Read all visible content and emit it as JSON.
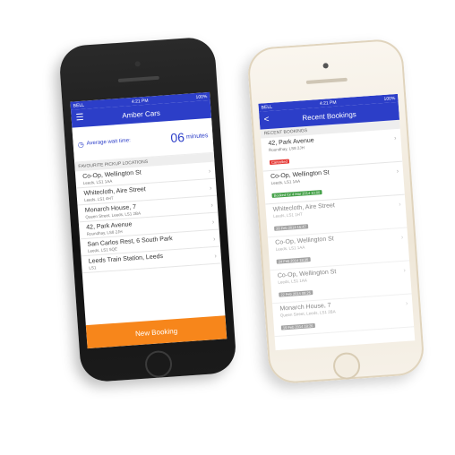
{
  "left": {
    "status": {
      "carrier": "BELL",
      "time": "4:21 PM",
      "battery": "100%"
    },
    "nav": {
      "title": "Amber Cars"
    },
    "wait": {
      "label": "Average wait time:",
      "value": "06",
      "unit": "minutes"
    },
    "section": "FAVOURITE PICKUP LOCATIONS",
    "locations": [
      {
        "title": "Co-Op, Wellington St",
        "sub": "Leeds, LS1 1AA"
      },
      {
        "title": "Whitecloth, Aire Street",
        "sub": "Leeds, LS1 4HT"
      },
      {
        "title": "Monarch House, 7",
        "sub": "Queen Street, Leeds, LS1 2BA"
      },
      {
        "title": "42, Park Avenue",
        "sub": "Roundhay, LS8 2JH"
      },
      {
        "title": "San Carlos Rest, 6 South Park",
        "sub": "Leeds, LS1 5QE"
      },
      {
        "title": "Leeds Train Station, Leeds",
        "sub": "LS1"
      }
    ],
    "cta": "New Booking"
  },
  "right": {
    "status": {
      "carrier": "BELL",
      "time": "4:21 PM",
      "battery": "100%"
    },
    "nav": {
      "title": "Recent Bookings",
      "back": "<"
    },
    "section": "RECENT BOOKINGS",
    "bookings": [
      {
        "title": "42, Park Avenue",
        "sub": "Roundhay, LS8 2JH",
        "badge": "Cancelled",
        "color": "#e53935"
      },
      {
        "title": "Co-Op, Wellington St",
        "sub": "Leeds, LS1 1AA",
        "badge": "Booked for 4 Mar 2014 10:00",
        "color": "#43a047"
      },
      {
        "title": "Whitecloth, Aire Street",
        "sub": "Leeds, LS1 1HT",
        "badge": "28 Feb 2014 15:47",
        "color": "#666666",
        "faded": true
      },
      {
        "title": "Co-Op, Wellington St",
        "sub": "Leeds, LS1 1AA",
        "badge": "24 Feb 2014 18:35",
        "color": "#666666",
        "faded": true
      },
      {
        "title": "Co-Op, Wellington St",
        "sub": "Leeds, LS1 1AA",
        "badge": "22 Feb 2014 09:25",
        "color": "#666666",
        "faded": true
      },
      {
        "title": "Monarch House, 7",
        "sub": "Queen Street, Leeds, LS1 2BA",
        "badge": "19 Feb 2014 18:26",
        "color": "#666666",
        "faded": true
      }
    ]
  }
}
